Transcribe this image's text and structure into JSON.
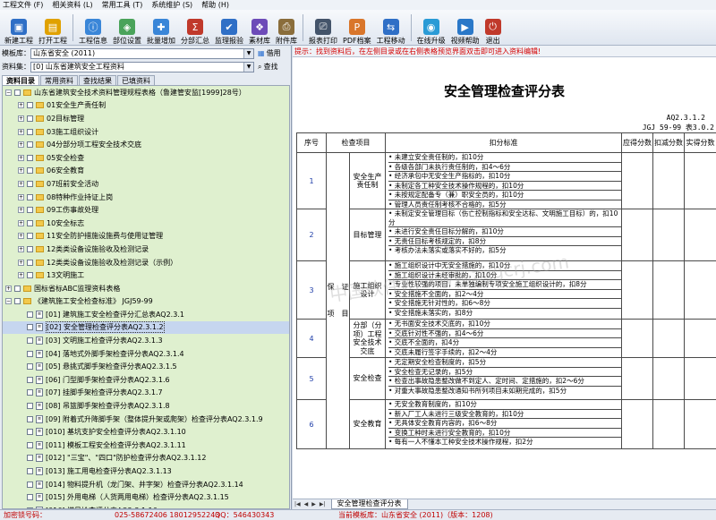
{
  "menu": [
    "工程文件 (F)",
    "相关资料 (L)",
    "常用工具 (T)",
    "系统维护 (S)",
    "帮助 (H)"
  ],
  "toolbar": [
    {
      "label": "新建工程",
      "icon": "new-project-icon",
      "color": "#2f6fc6",
      "glyph": "▣"
    },
    {
      "label": "打开工程",
      "icon": "open-project-icon",
      "color": "#e0a100",
      "glyph": "▤"
    },
    {
      "label": "工程信息",
      "icon": "project-info-icon",
      "color": "#3a86d8",
      "glyph": "ⓘ"
    },
    {
      "label": "部位设置",
      "icon": "location-settings-icon",
      "color": "#4aa35a",
      "glyph": "◈"
    },
    {
      "label": "批量增加",
      "icon": "batch-add-icon",
      "color": "#3a86d8",
      "glyph": "✚"
    },
    {
      "label": "分部汇总",
      "icon": "summary-icon",
      "color": "#c0392b",
      "glyph": "Σ"
    },
    {
      "label": "监理报验",
      "icon": "inspection-icon",
      "color": "#2f6fc6",
      "glyph": "✔"
    },
    {
      "label": "素材库",
      "icon": "material-library-icon",
      "color": "#6d4bb8",
      "glyph": "❖"
    },
    {
      "label": "附件库",
      "icon": "attachment-library-icon",
      "color": "#8a6d3b",
      "glyph": "⎙"
    },
    {
      "label": "报表打印",
      "icon": "print-icon",
      "color": "#44546a",
      "glyph": "⎚"
    },
    {
      "label": "PDF档案",
      "icon": "pdf-icon",
      "color": "#d9762b",
      "glyph": "P"
    },
    {
      "label": "工程移动",
      "icon": "project-move-icon",
      "color": "#2f6fc6",
      "glyph": "⇆"
    },
    {
      "label": "在线升级",
      "icon": "online-upgrade-icon",
      "color": "#2a9bd6",
      "glyph": "◉"
    },
    {
      "label": "视频帮助",
      "icon": "video-help-icon",
      "color": "#2a78c8",
      "glyph": "▶"
    },
    {
      "label": "退出",
      "icon": "exit-icon",
      "color": "#c0392b",
      "glyph": "⏻"
    }
  ],
  "left": {
    "template_label": "模板库：",
    "template_value": "山东省安全 (2011)",
    "use_button": "借用",
    "dataset_label": "资料集：",
    "dataset_value": "[0] 山东省建筑安全工程资料",
    "find_button": "查找",
    "tabs": [
      "资料目录",
      "常用资料",
      "查找结果",
      "已填资料"
    ],
    "tree": [
      {
        "indent": 0,
        "exp": "⊟",
        "chk": true,
        "icon": "folder",
        "text": "山东省建筑安全技术资料管理规程表格（鲁建管安监[1999]28号）"
      },
      {
        "indent": 1,
        "exp": "⊞",
        "chk": true,
        "icon": "folder",
        "text": "01安全生产责任制"
      },
      {
        "indent": 1,
        "exp": "⊞",
        "chk": true,
        "icon": "folder",
        "text": "02目标管理"
      },
      {
        "indent": 1,
        "exp": "⊞",
        "chk": true,
        "icon": "folder",
        "text": "03施工组织设计"
      },
      {
        "indent": 1,
        "exp": "⊞",
        "chk": true,
        "icon": "folder",
        "text": "04分部分项工程安全技术交底"
      },
      {
        "indent": 1,
        "exp": "⊞",
        "chk": true,
        "icon": "folder",
        "text": "05安全检查"
      },
      {
        "indent": 1,
        "exp": "⊞",
        "chk": true,
        "icon": "folder",
        "text": "06安全教育"
      },
      {
        "indent": 1,
        "exp": "⊞",
        "chk": true,
        "icon": "folder",
        "text": "07班前安全活动"
      },
      {
        "indent": 1,
        "exp": "⊞",
        "chk": true,
        "icon": "folder",
        "text": "08特种作业持证上岗"
      },
      {
        "indent": 1,
        "exp": "⊞",
        "chk": true,
        "icon": "folder",
        "text": "09工伤事故处理"
      },
      {
        "indent": 1,
        "exp": "⊞",
        "chk": true,
        "icon": "folder",
        "text": "10安全标志"
      },
      {
        "indent": 1,
        "exp": "⊞",
        "chk": true,
        "icon": "folder",
        "text": "11安全防护措施设施费与使用证管理"
      },
      {
        "indent": 1,
        "exp": "⊞",
        "chk": true,
        "icon": "folder",
        "text": "12类类设备设施验收及检测记录"
      },
      {
        "indent": 1,
        "exp": "⊞",
        "chk": true,
        "icon": "folder",
        "text": "12类类设备设施验收及检测记录（示例）"
      },
      {
        "indent": 1,
        "exp": "⊞",
        "chk": true,
        "icon": "folder",
        "text": "13文明施工"
      },
      {
        "indent": 0,
        "exp": "⊞",
        "chk": true,
        "icon": "folder",
        "text": "国标省标ABC监理资料表格"
      },
      {
        "indent": 0,
        "exp": "⊟",
        "chk": true,
        "icon": "folder",
        "text": "《建筑施工安全检查标准》 JGJ59-99"
      },
      {
        "indent": 1,
        "exp": "",
        "chk": true,
        "icon": "doc",
        "text": "[01] 建筑施工安全检查评分汇总表AQ2.3.1"
      },
      {
        "indent": 1,
        "exp": "",
        "chk": true,
        "icon": "doc",
        "text": "[02] 安全管理检查评分表AQ2.3.1.2",
        "selected": true
      },
      {
        "indent": 1,
        "exp": "",
        "chk": true,
        "icon": "doc",
        "text": "[03] 文明施工检查评分表AQ2.3.1.3"
      },
      {
        "indent": 1,
        "exp": "",
        "chk": true,
        "icon": "doc",
        "text": "[04] 落地式外脚手架检查评分表AQ2.3.1.4"
      },
      {
        "indent": 1,
        "exp": "",
        "chk": true,
        "icon": "doc",
        "text": "[05] 悬挑式脚手架检查评分表AQ2.3.1.5"
      },
      {
        "indent": 1,
        "exp": "",
        "chk": true,
        "icon": "doc",
        "text": "[06] 门型脚手架检查评分表AQ2.3.1.6"
      },
      {
        "indent": 1,
        "exp": "",
        "chk": true,
        "icon": "doc",
        "text": "[07] 挂脚手架检查评分表AQ2.3.1.7"
      },
      {
        "indent": 1,
        "exp": "",
        "chk": true,
        "icon": "doc",
        "text": "[08] 吊篮脚手架检查评分表AQ2.3.1.8"
      },
      {
        "indent": 1,
        "exp": "",
        "chk": true,
        "icon": "doc",
        "text": "[09] 附着式升降脚手架（整体提升架或爬架）检查评分表AQ2.3.1.9"
      },
      {
        "indent": 1,
        "exp": "",
        "chk": true,
        "icon": "doc",
        "text": "[010] 基坑支护安全检查评分表AQ2.3.1.10"
      },
      {
        "indent": 1,
        "exp": "",
        "chk": true,
        "icon": "doc",
        "text": "[011] 模板工程安全检查评分表AQ2.3.1.11"
      },
      {
        "indent": 1,
        "exp": "",
        "chk": true,
        "icon": "doc",
        "text": "[012] \"三宝\"、\"四口\"防护检查评分表AQ2.3.1.12"
      },
      {
        "indent": 1,
        "exp": "",
        "chk": true,
        "icon": "doc",
        "text": "[013] 施工用电检查评分表AQ2.3.1.13"
      },
      {
        "indent": 1,
        "exp": "",
        "chk": true,
        "icon": "doc",
        "text": "[014] 物料提升机（龙门架、井字架）检查评分表AQ2.3.1.14"
      },
      {
        "indent": 1,
        "exp": "",
        "chk": true,
        "icon": "doc",
        "text": "[015] 外用电梯（人货两用电梯）检查评分表AQ2.3.1.15"
      },
      {
        "indent": 1,
        "exp": "",
        "chk": true,
        "icon": "doc",
        "text": "[016] 塔吊检查评分表AQ2.3.1.16"
      },
      {
        "indent": 1,
        "exp": "",
        "chk": true,
        "icon": "doc",
        "text": "[017] 起重吊装安全检查评分表AQ2.3.1.17"
      }
    ]
  },
  "right": {
    "hint": "提示：找到资料后，在左侧目录或在右侧表格预览界面双击即可进入资料编辑!",
    "doc_title": "安全管理检查评分表",
    "doc_code1": "AQ2.3.1.2",
    "doc_code2": "JGJ 59-99 表3.0.2",
    "headers": [
      "序号",
      "检查项目",
      "扣分标准",
      "应得分数",
      "扣减分数",
      "实得分数"
    ],
    "category": "保　证　项　目",
    "groups": [
      {
        "no": "1",
        "item": "安全生产责任制",
        "lines": [
          "• 未建立安全责任制的，扣10分",
          "• 各级各部门未执行责任制的，扣4～6分",
          "• 经济承包中无安全生产指标的，扣10分",
          "• 未制定各工种安全技术操作规程的，扣10分",
          "• 未按规定配备专（兼）职安全员的，扣10分",
          "• 管理人员责任制考核不合格的，扣5分"
        ]
      },
      {
        "no": "2",
        "item": "目标管理",
        "lines": [
          "• 未制定安全管理目标（伤亡控制指标和安全达标、文明施工目标）的，扣10分",
          "• 未进行安全责任目标分解的，扣10分",
          "• 无责任目标考核规定的，扣8分",
          "• 考核办法未落实或落实不好的，扣5分"
        ]
      },
      {
        "no": "3",
        "item": "施工组织设计",
        "lines": [
          "• 施工组织设计中无安全措施的，扣10分",
          "• 施工组织设计未经审批的，扣10分",
          "• 专业性较强的项目，未单独编制专项安全施工组织设计的，扣8分",
          "• 安全措施不全面的，扣2～4分",
          "• 安全措施无针对性的，扣6～8分",
          "• 安全措施未落实的，扣8分"
        ]
      },
      {
        "no": "4",
        "item": "分部（分项）工程安全技术交底",
        "lines": [
          "• 无书面安全技术交底的，扣10分",
          "• 交底针对性不强的，扣4～6分",
          "• 交底不全面的，扣4分",
          "• 交底未履行签字手续的，扣2～4分"
        ]
      },
      {
        "no": "5",
        "item": "安全检查",
        "lines": [
          "• 无定期安全检查制度的，扣5分",
          "• 安全检查无记录的，扣5分",
          "• 检查出事故隐患整改做不到定人、定时间、定措施的，扣2～6分",
          "• 对重大事故隐患整改通知书所列项目未如期完成的，扣5分"
        ]
      },
      {
        "no": "6",
        "item": "安全教育",
        "lines": [
          "• 无安全教育制度的，扣10分",
          "• 新入厂工人未进行三级安全教育的，扣10分",
          "• 无具体安全教育内容的，扣6～8分",
          "• 变换工种时未进行安全教育的，扣10分",
          "• 每有一人不懂本工种安全技术操作规程，扣2分"
        ]
      }
    ],
    "watermark": "中国软件网 www.zggcrj.com",
    "sheet_tab": "安全管理检查评分表"
  },
  "status": {
    "lock": "加密锁号码：",
    "phone": "025-58672406 18012952243",
    "qq": "QQ：546430343",
    "current": "当前模板库：山东省安全 (2011)（版本：1208)"
  }
}
